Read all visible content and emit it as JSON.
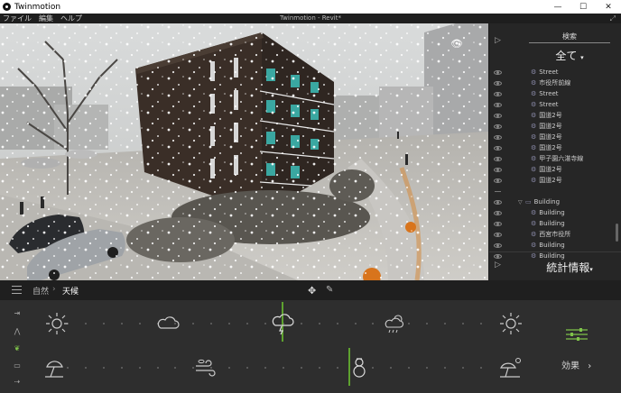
{
  "window": {
    "app_title": "Twinmotion",
    "document_title": "Twinmotion - Revit*",
    "minimize": "—",
    "maximize": "☐",
    "close": "✕"
  },
  "menu": {
    "items": [
      "ファイル",
      "編集",
      "ヘルプ"
    ]
  },
  "panel": {
    "search_label": "検索",
    "filter_label": "全て",
    "stats_label": "統計情報",
    "rows": [
      {
        "label": "Street",
        "visible": true
      },
      {
        "label": "市役所前線",
        "visible": true
      },
      {
        "label": "Street",
        "visible": true
      },
      {
        "label": "Street",
        "visible": true
      },
      {
        "label": "国道2号",
        "visible": true
      },
      {
        "label": "国道2号",
        "visible": true
      },
      {
        "label": "国道2号",
        "visible": true
      },
      {
        "label": "国道2号",
        "visible": true
      },
      {
        "label": "甲子園六湛寺線",
        "visible": true
      },
      {
        "label": "国道2号",
        "visible": true
      },
      {
        "label": "国道2号",
        "visible": true
      },
      {
        "label": "",
        "visible": false
      },
      {
        "label": "Building",
        "visible": true,
        "folder": true
      },
      {
        "label": "Building",
        "visible": true
      },
      {
        "label": "Building",
        "visible": true
      },
      {
        "label": "西宮市役所",
        "visible": true
      },
      {
        "label": "Building",
        "visible": true
      },
      {
        "label": "Building",
        "visible": true
      }
    ]
  },
  "breadcrumb": {
    "parent": "自然",
    "current": "天候"
  },
  "bottom": {
    "effects_label": "効果"
  },
  "icons": {
    "move": "move-icon",
    "pen": "pen-icon",
    "menu": "hamburger-icon"
  },
  "colors": {
    "accent": "#5ea22f"
  }
}
